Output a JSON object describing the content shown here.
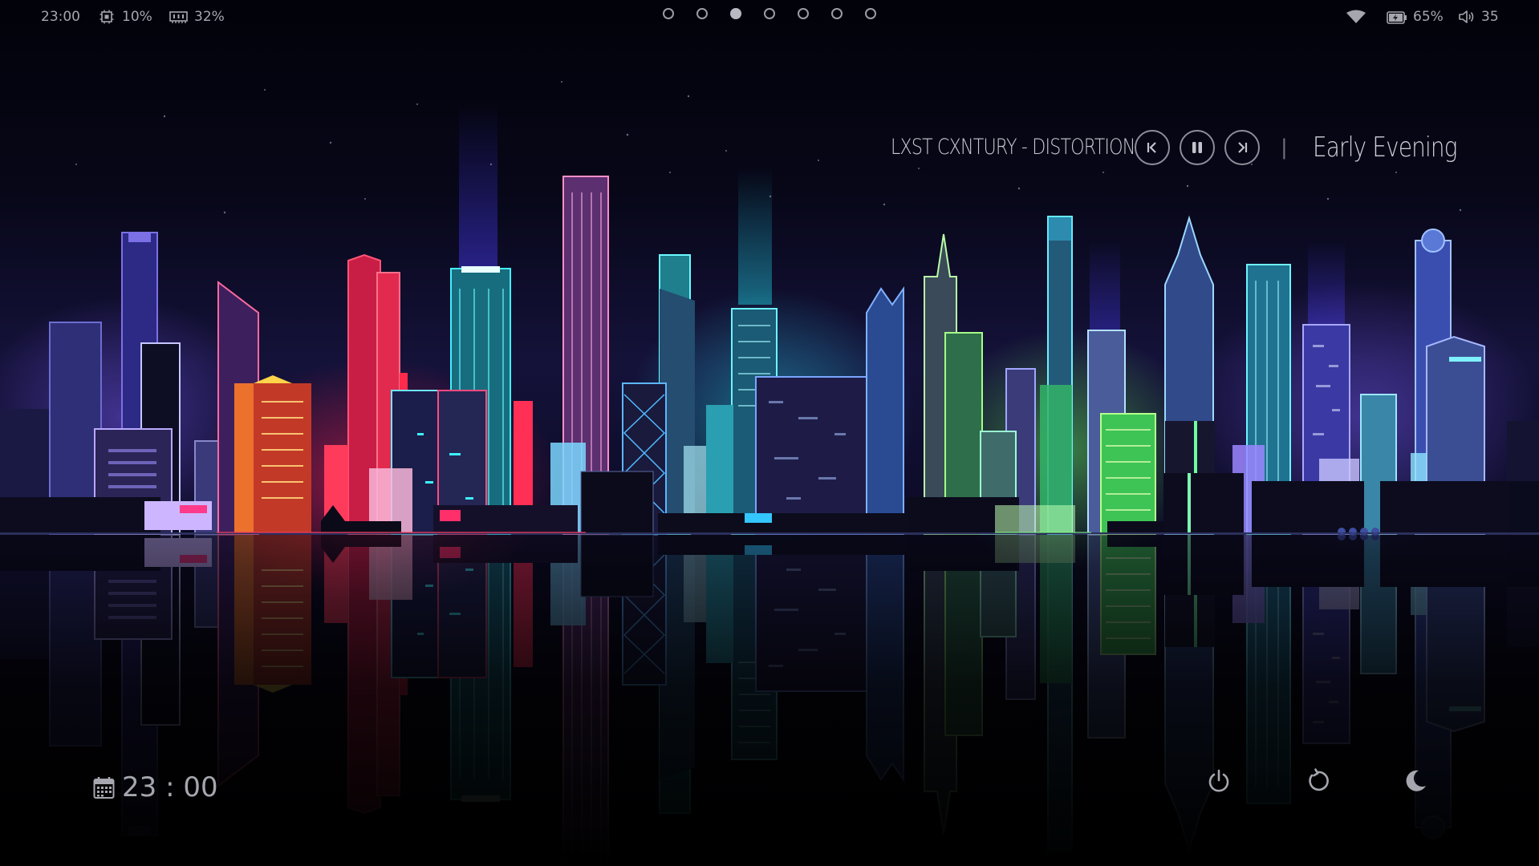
{
  "topbar": {
    "time": "23:00",
    "cpu": {
      "icon": "cpu-icon",
      "value": "10%"
    },
    "memory": {
      "icon": "memory-icon",
      "value": "32%"
    },
    "workspaces": {
      "count": 7,
      "active_index": 2
    },
    "wifi": {
      "icon": "wifi-icon"
    },
    "battery": {
      "icon": "battery-charging-icon",
      "value": "65%"
    },
    "volume": {
      "icon": "speaker-icon",
      "value": "35"
    }
  },
  "player": {
    "track": "LXST CXNTURY - DISTORTION",
    "controls": [
      "previous",
      "pause",
      "next"
    ],
    "separator": "|",
    "greeting": "Early Evening"
  },
  "clock": {
    "icon": "calendar-icon",
    "value": "23 : 00"
  },
  "session": {
    "buttons": [
      {
        "icon": "power-icon",
        "action": "shutdown"
      },
      {
        "icon": "restart-icon",
        "action": "reboot"
      },
      {
        "icon": "moon-icon",
        "action": "sleep"
      }
    ]
  },
  "colors": {
    "text": "#a5a6ae",
    "accent_red": "#ff2a5a",
    "accent_cyan": "#39e6ff",
    "accent_green": "#7dff7a",
    "accent_purple": "#8a6cff"
  }
}
